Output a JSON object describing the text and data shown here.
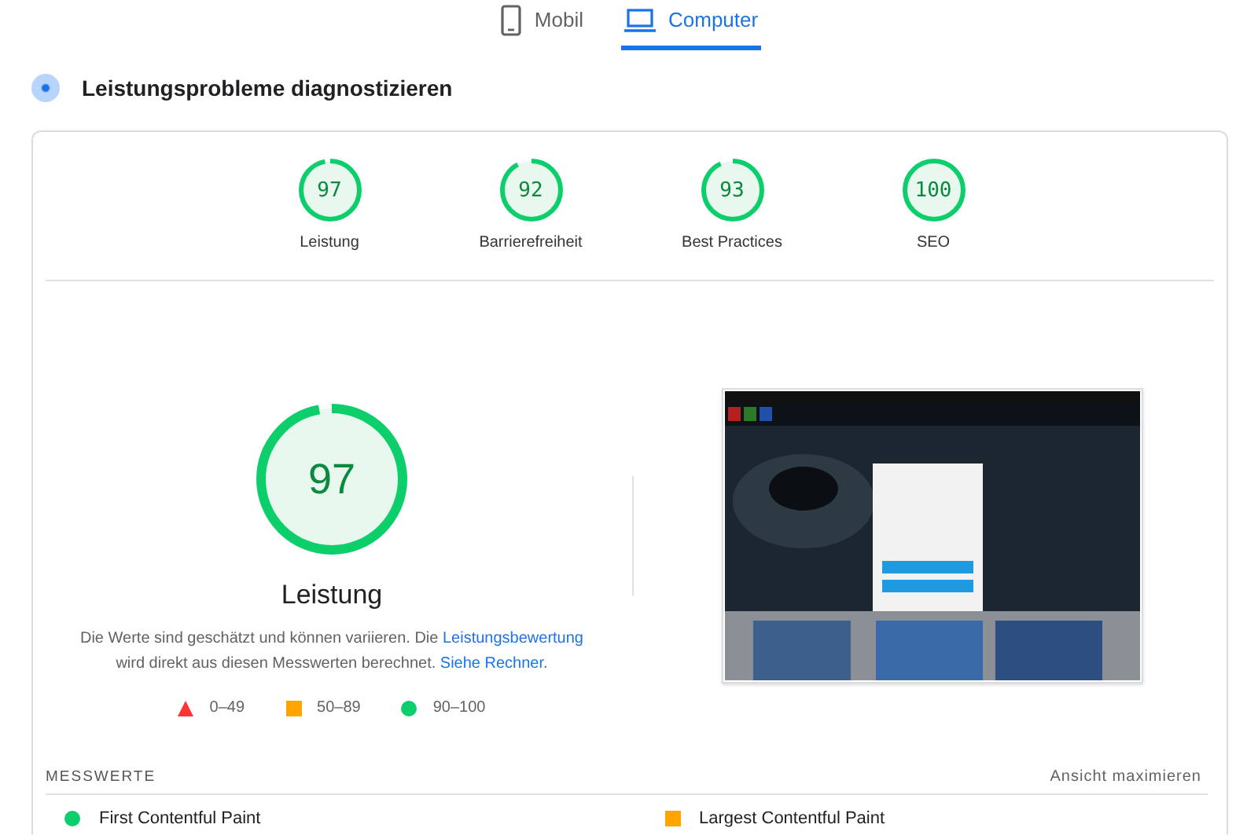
{
  "tabs": [
    {
      "label": "Mobil",
      "kind": "mobile",
      "selected": false
    },
    {
      "label": "Computer",
      "kind": "desktop",
      "selected": true
    }
  ],
  "section_title": "Leistungsprobleme diagnostizieren",
  "categories": [
    {
      "score": "97",
      "label": "Leistung",
      "level": 0.97
    },
    {
      "score": "92",
      "label": "Barrierefreiheit",
      "level": 0.92
    },
    {
      "score": "93",
      "label": "Best Practices",
      "level": 0.93
    },
    {
      "score": "100",
      "label": "SEO",
      "level": 1
    }
  ],
  "main_gauge": {
    "score": "97",
    "level": 0.97,
    "title": "Leistung"
  },
  "description": [
    {
      "kind": "text",
      "text": "Die Werte sind geschätzt und können variieren. Die "
    },
    {
      "kind": "link",
      "text": "Leistungsbewertung"
    },
    {
      "kind": "text",
      "text": " wird direkt aus diesen Messwerten berechnet. "
    },
    {
      "kind": "link",
      "text": "Siehe Rechner"
    },
    {
      "kind": "text",
      "text": "."
    }
  ],
  "legend": [
    {
      "kind": "fail",
      "color": "#ff3333",
      "label": "0–49"
    },
    {
      "kind": "average",
      "color": "#ffa400",
      "label": "50–89"
    },
    {
      "kind": "pass",
      "color": "#0cce6b",
      "label": "90–100"
    }
  ],
  "metrics_heading": "MESSWERTE",
  "expand_link": "Ansicht maximieren",
  "metrics": [
    {
      "name": "First Contentful Paint",
      "kind": "pass",
      "color": "#0cce6b"
    },
    {
      "name": "Largest Contentful Paint",
      "kind": "average",
      "color": "#ffa400"
    }
  ]
}
